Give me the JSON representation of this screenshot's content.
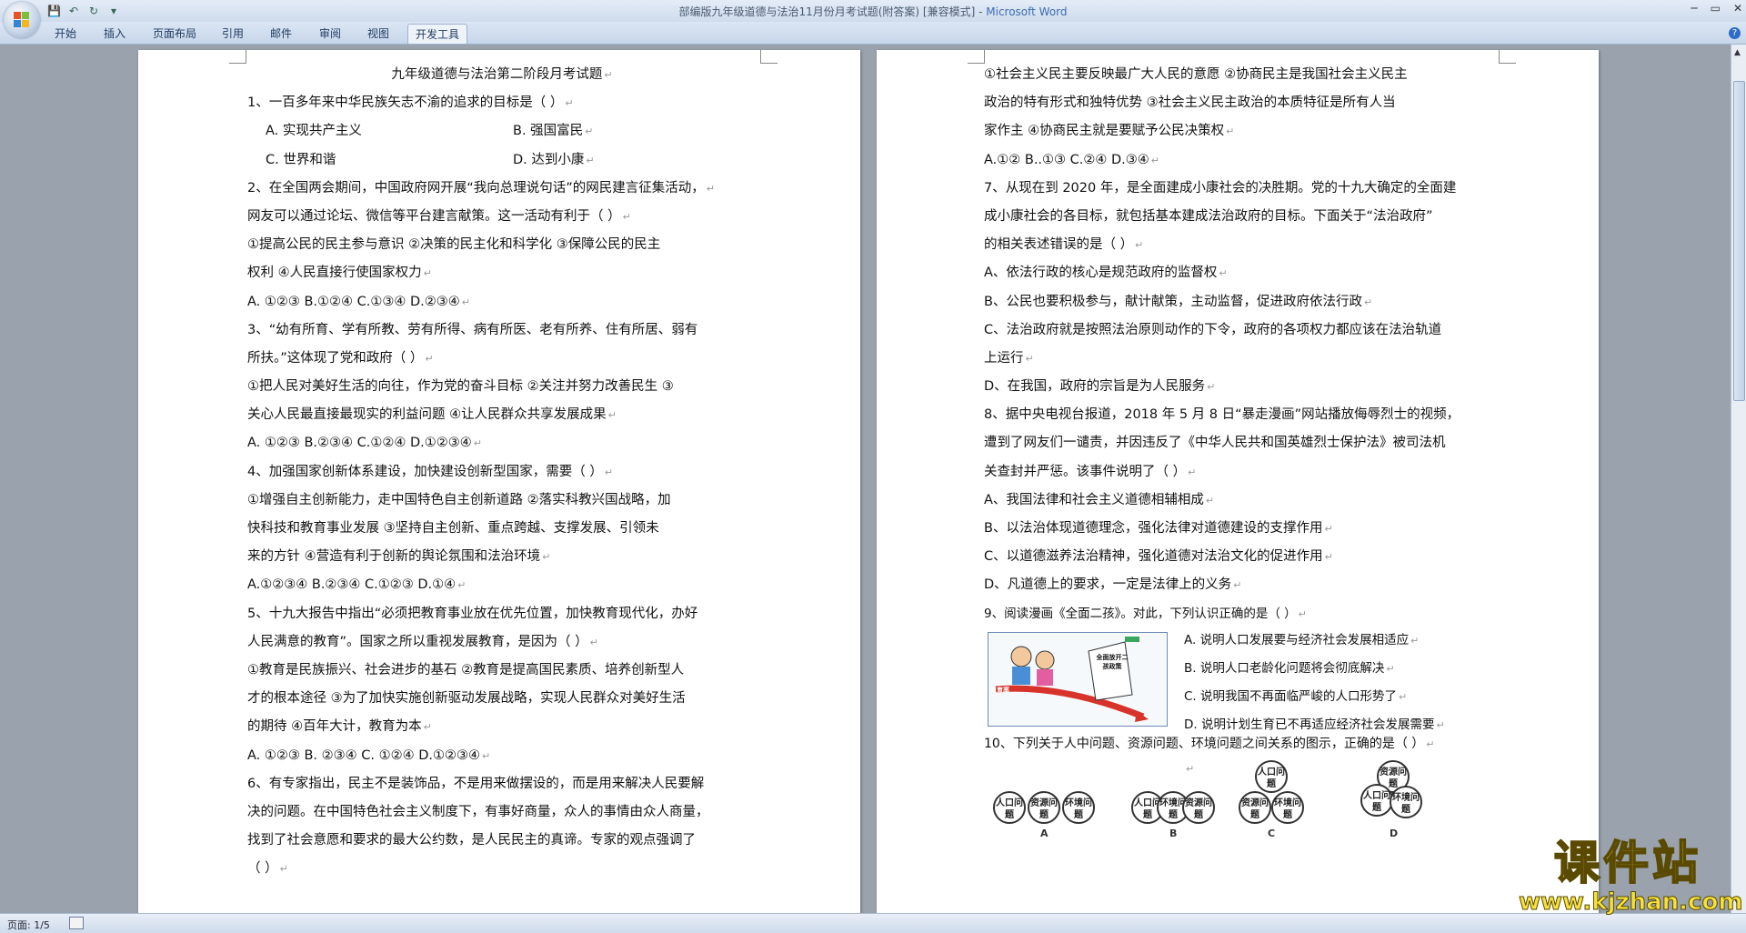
{
  "window": {
    "title_prefix": "部编版九年级道德与法治11月份月考试题(附答案) [兼容模式] - ",
    "app_name": "Microsoft Word"
  },
  "ribbon": {
    "tabs": [
      "开始",
      "插入",
      "页面布局",
      "引用",
      "邮件",
      "审阅",
      "视图",
      "开发工具"
    ],
    "active_tab": "开发工具"
  },
  "status": {
    "page": "页面: 1/5"
  },
  "page1": {
    "title": "九年级道德与法治第二阶段月考试题",
    "lines": [
      "1、一百多年来中华民族矢志不渝的追求的目标是（      ）",
      "2、在全国两会期间，中国政府网开展“我向总理说句话”的网民建言征集活动，",
      "网友可以通过论坛、微信等平台建言献策。这一活动有利于（      ）",
      "①提高公民的民主参与意识        ②决策的民主化和科学化    ③保障公民的民主",
      "权利        ④人民直接行使国家权力",
      "A. ①②③            B.①②④             C.①③④             D.②③④",
      "3、“幼有所育、学有所教、劳有所得、病有所医、老有所养、住有所居、弱有",
      "所扶。”这体现了党和政府（     ）",
      "①把人民对美好生活的向往，作为党的奋斗目标      ②关注并努力改善民生    ③",
      "关心人民最直接最现实的利益问题      ④让人民群众共享发展成果",
      "A. ①②③          B.②③④        C.①②④             D.①②③④",
      "4、加强国家创新体系建设，加快建设创新型国家，需要（      ）",
      "①增强自主创新能力，走中国特色自主创新道路        ②落实科教兴国战略，加",
      "快科技和教育事业发展            ③坚持自主创新、重点跨越、支撑发展、引领未",
      "来的方针            ④营造有利于创新的舆论氛围和法治环境",
      "A.①②③④              B.②③④      C.①②③           D.①④",
      "5、十九大报告中指出“必须把教育事业放在优先位置，加快教育现代化，办好",
      "人民满意的教育”。国家之所以重视发展教育，是因为（          ）",
      "①教育是民族振兴、社会进步的基石        ②教育是提高国民素质、培养创新型人",
      "才的根本途径        ③为了加快实施创新驱动发展战略，实现人民群众对美好生活",
      "的期待          ④百年大计，教育为本",
      "A. ①②③          B. ②③④            C. ①②④             D.①②③④",
      "6、有专家指出，民主不是装饰品，不是用来做摆设的，而是用来解决人民要解",
      "决的问题。在中国特色社会主义制度下，有事好商量，众人的事情由众人商量，",
      "找到了社会意愿和要求的最大公约数，是人民民主的真谛。专家的观点强调了",
      "（      ）"
    ],
    "q1_opts": [
      "A.  实现共产主义",
      "B.  强国富民",
      "C.  世界和谐",
      "D.  达到小康"
    ]
  },
  "page2": {
    "lines": [
      "①社会主义民主要反映最广大人民的意愿          ②协商民主是我国社会主义民主",
      "政治的特有形式和独特优势              ③社会主义民主政治的本质特征是所有人当",
      "家作主        ④协商民主就是要赋予公民决策权",
      "A.①②             B..①③               C.②④            D.③④",
      "7、从现在到 2020 年，是全面建成小康社会的决胜期。党的十九大确定的全面建",
      "成小康社会的各目标，就包括基本建成法治政府的目标。下面关于“法治政府”",
      "的相关表述错误的是（      ）",
      "A、依法行政的核心是规范政府的监督权",
      "B、公民也要积极参与，献计献策，主动监督，促进政府依法行政",
      "C、法治政府就是按照法治原则动作的下令，政府的各项权力都应该在法治轨道",
      "上运行",
      "D、在我国，政府的宗旨是为人民服务",
      "8、据中央电视台报道，2018 年 5 月 8 日“暴走漫画”网站播放侮辱烈士的视频，",
      "遭到了网友们一谴责，并因违反了《中华人民共和国英雄烈士保护法》被司法机",
      "关查封并严惩。该事件说明了（      ）",
      "A、我国法律和社会主义道德相辅相成",
      "B、以法治体现道德理念，强化法律对道德建设的支撑作用",
      "C、以道德滋养法治精神，强化道德对法治文化的促进作用",
      "D、凡道德上的要求，一定是法律上的义务",
      "9、阅读漫画《全面二孩》。对此，下列认识正确的是（     ）"
    ],
    "q9_opts": [
      "A. 说明人口发展要与经济社会发展相适应",
      "B. 说明人口老龄化问题将会彻底解决",
      "C. 说明我国不再面临严峻的人口形势了",
      "D. 说明计划生育已不再适应经济社会发展需要"
    ],
    "cartoon_sign": "全面放开二孩政策",
    "cartoon_label": "生育率",
    "q10": "10、下列关于人中问题、资源问题、环境问题之间关系的图示，正确的是（      ）",
    "circle_labels": {
      "pop": "人口问题",
      "res": "资源问题",
      "env": "环境问题"
    },
    "figure_letters": [
      "A",
      "B",
      "C",
      "D"
    ]
  },
  "watermark": {
    "cn": "课件站",
    "url": "www.kjzhan.com"
  }
}
